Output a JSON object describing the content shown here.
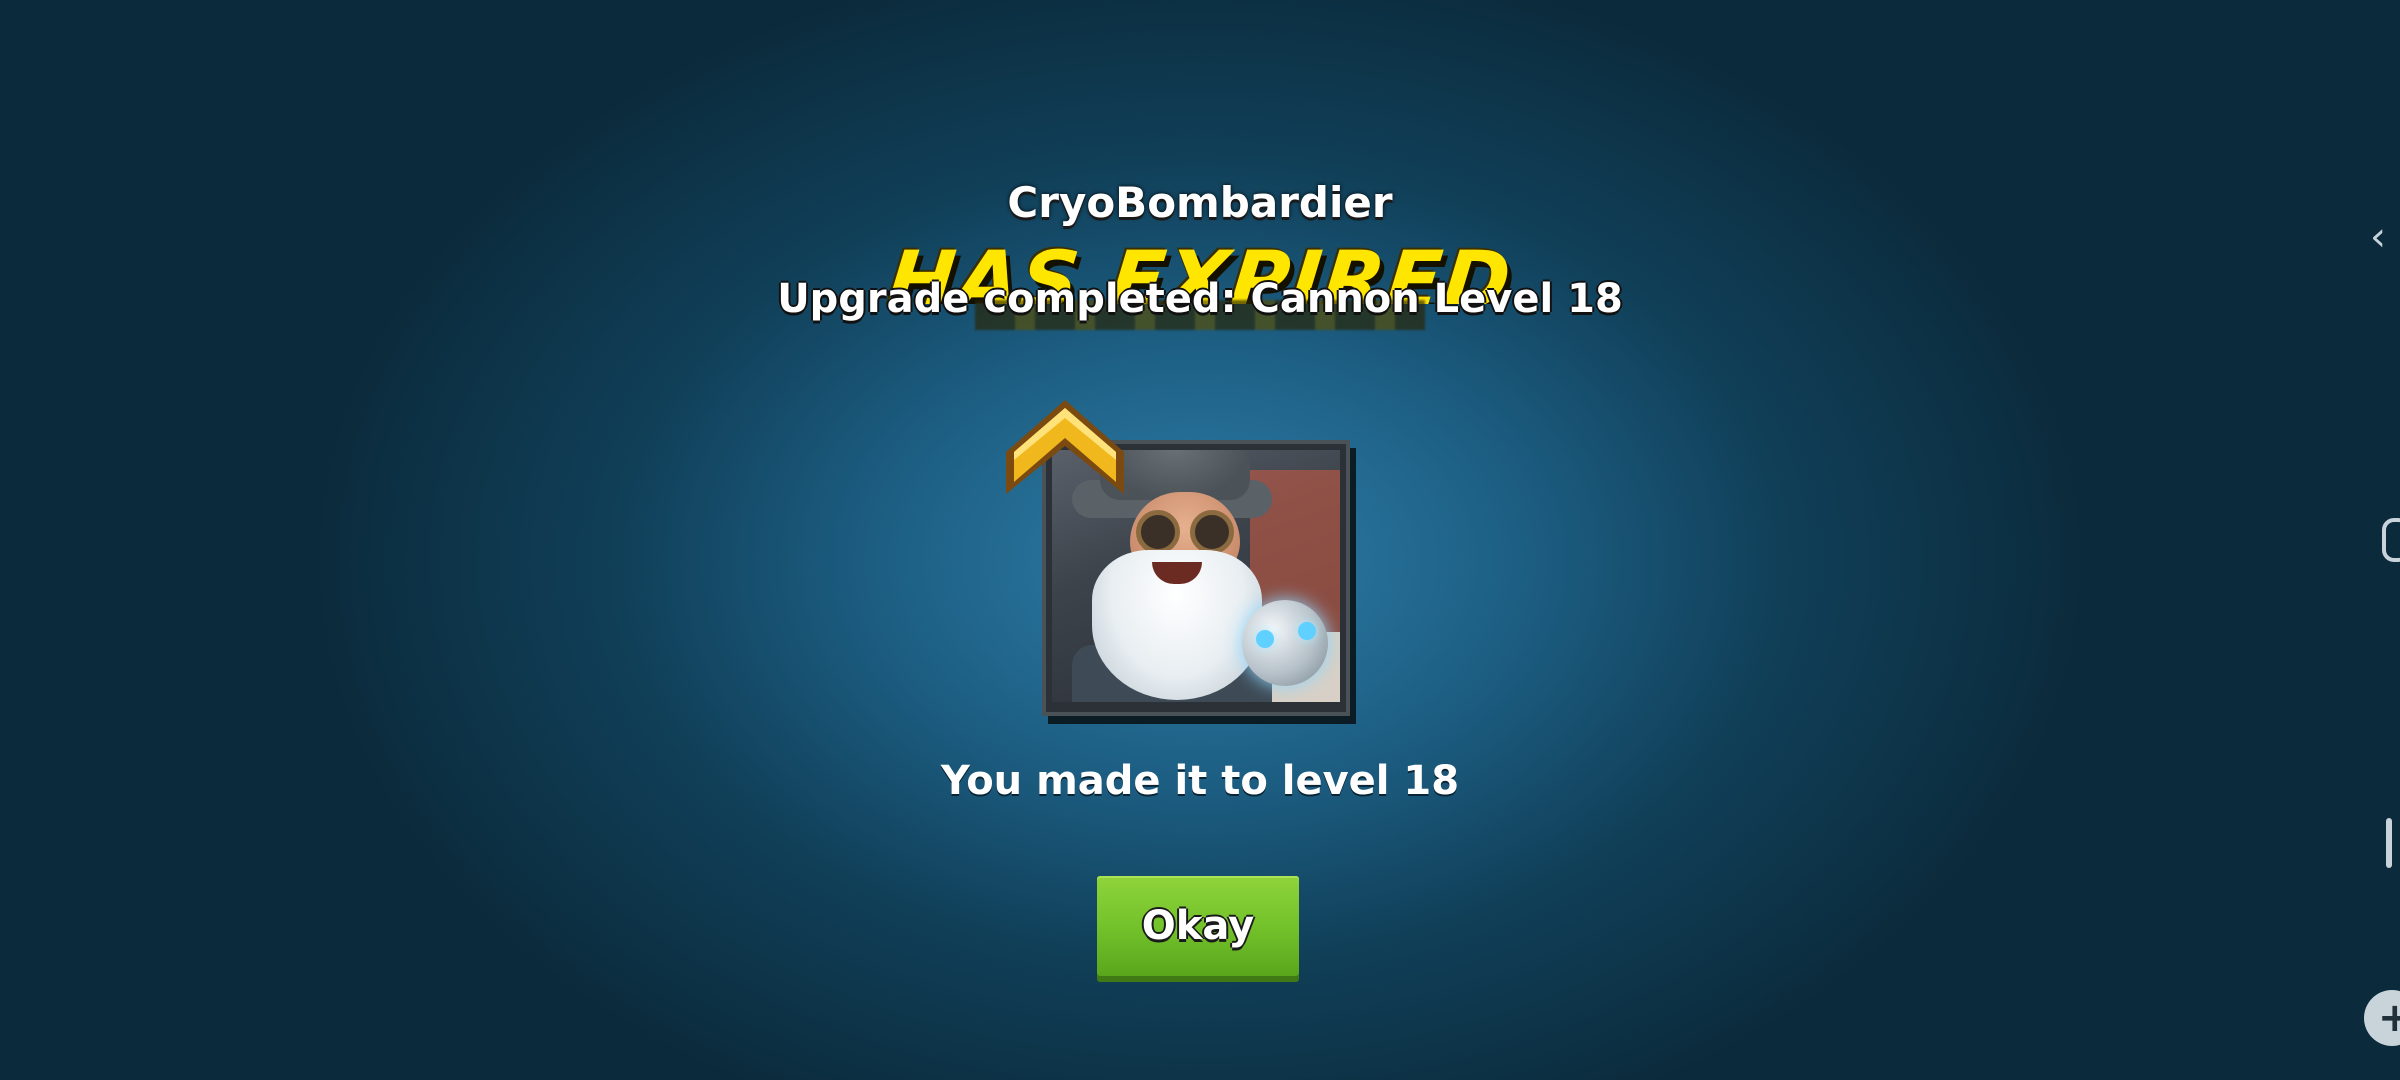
{
  "dialog": {
    "hero_name": "CryoBombardier",
    "banner_text": "HAS EXPIRED",
    "upgrade_text": "Upgrade completed: Cannon Level 18",
    "level_text": "You made it to level 18",
    "okay_label": "Okay"
  },
  "icons": {
    "level_up": "chevron-up-icon",
    "snowflake": "❄",
    "back": "‹",
    "plus": "+"
  },
  "colors": {
    "banner_yellow": "#ffe600",
    "button_green": "#71c02a",
    "chevron_gold": "#f0b81c"
  }
}
